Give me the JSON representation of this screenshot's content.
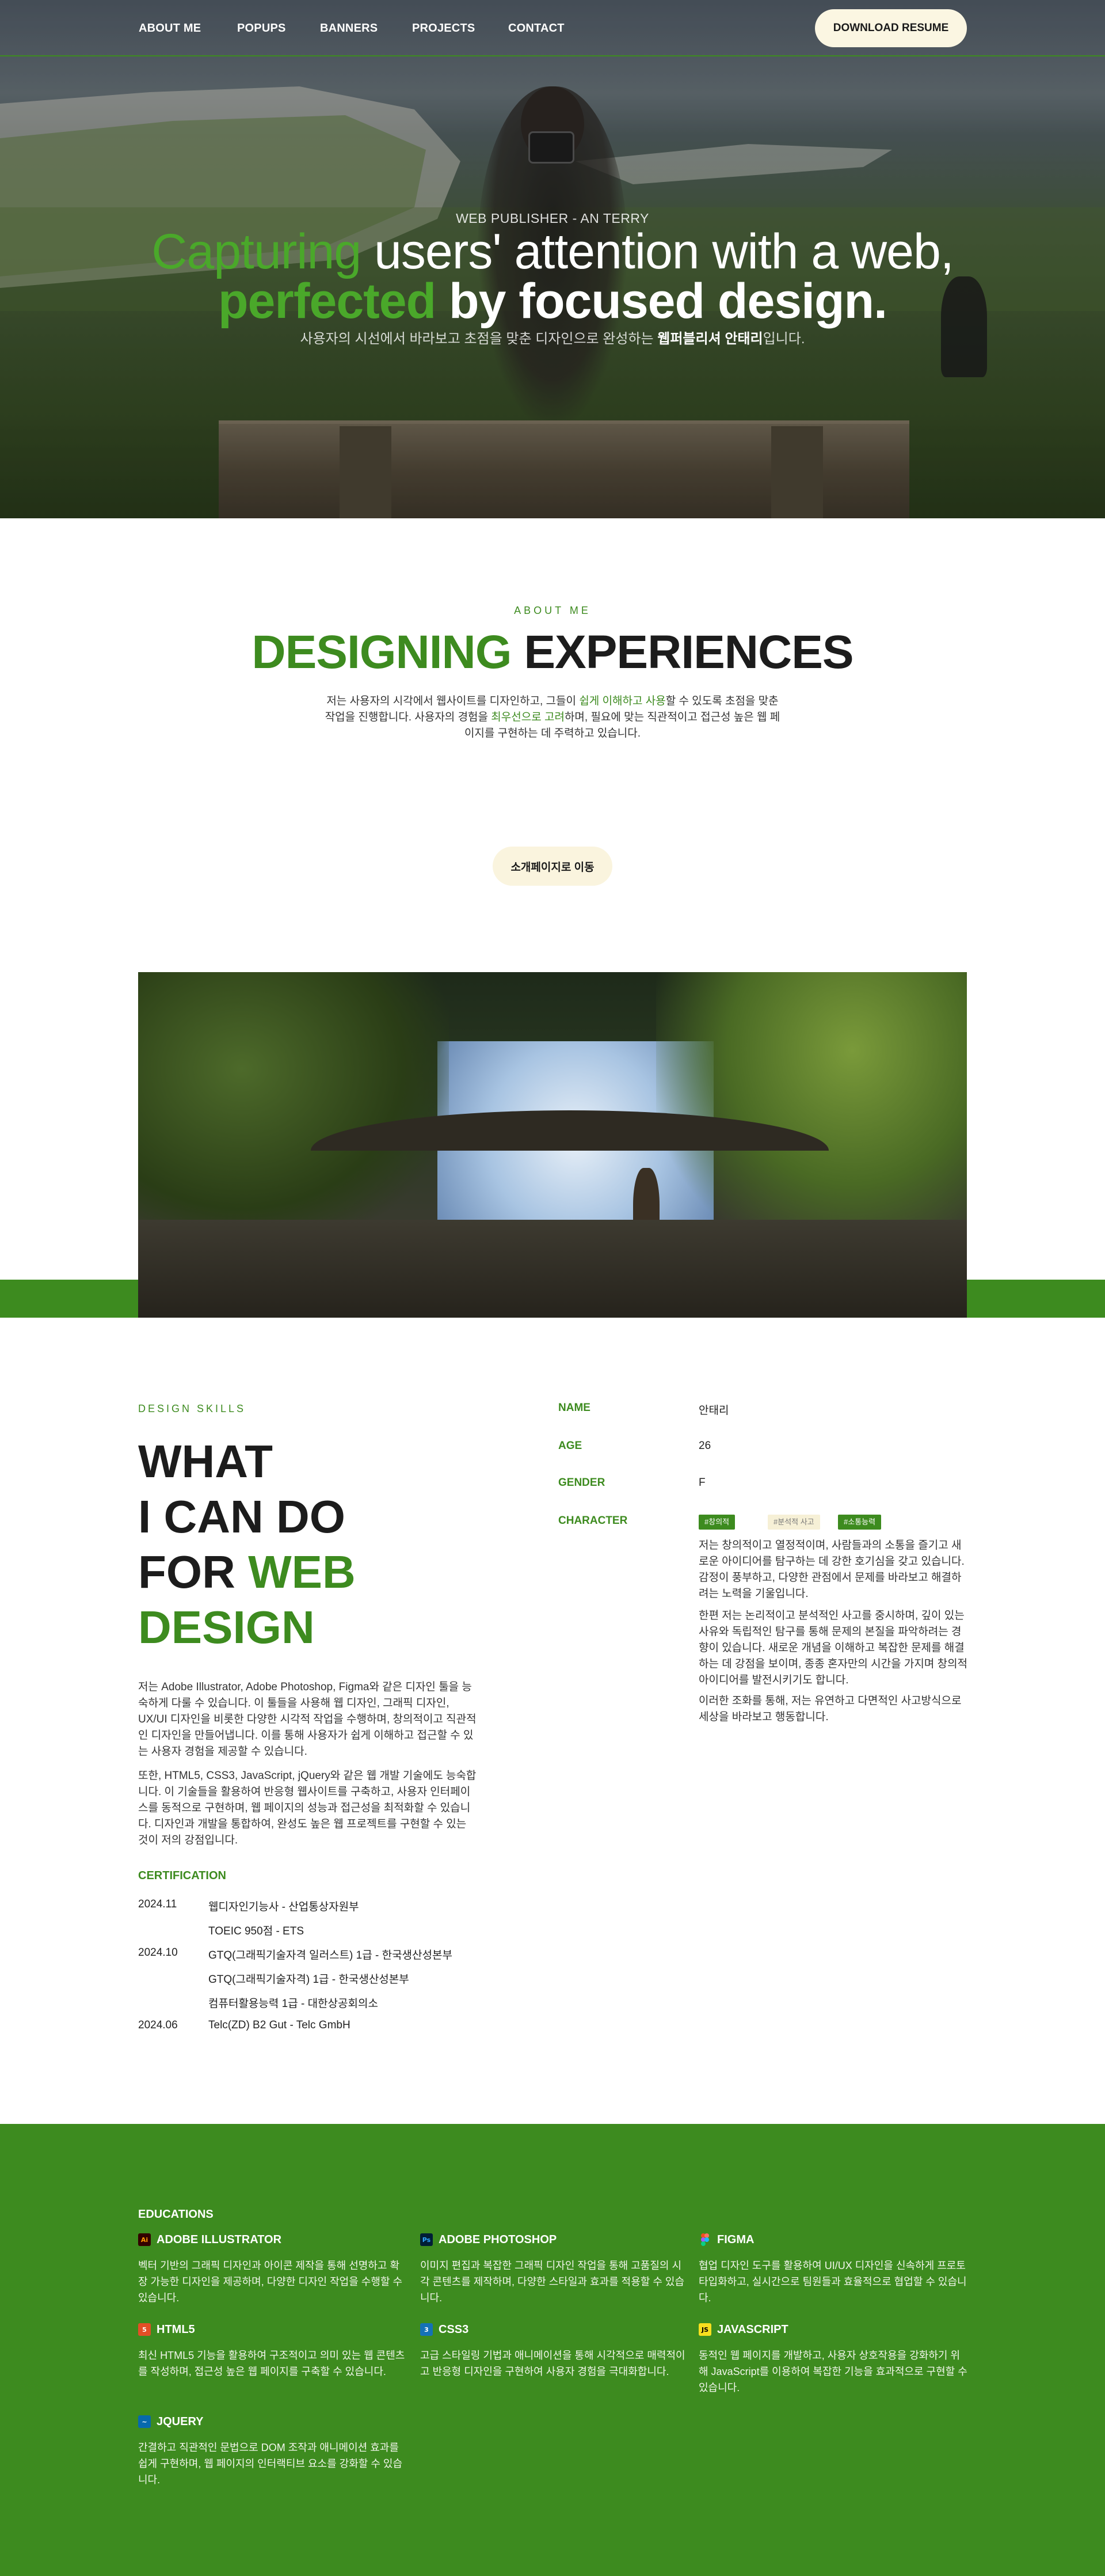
{
  "nav": {
    "items": [
      "ABOUT ME",
      "POPUPS",
      "BANNERS",
      "PROJECTS",
      "CONTACT"
    ],
    "resume_button": "DOWNLOAD RESUME"
  },
  "hero": {
    "subtitle": "WEB PUBLISHER - AN TERRY",
    "line1_green": "Capturing",
    "line1_rest": " users' attention with a web,",
    "line2_green": "perfected",
    "line2_rest": " by focused design.",
    "desc_pre": "사용자의 시선에서 바라보고 초점을 맞춘 디자인으로 완성하는 ",
    "desc_bold": "웹퍼블리셔 안태리",
    "desc_post": "입니다."
  },
  "about": {
    "label": "ABOUT ME",
    "title_green": "DESIGNING",
    "title_rest": " EXPERIENCES",
    "text_1": "저는 사용자의 시각에서 웹사이트를 디자인하고, 그들이 ",
    "text_hl1": "쉽게 이해하고 사용",
    "text_2": "할 수 있도록 초점을 맞춘 작업을 진행합니다. 사용자의 경험을 ",
    "text_hl2": "최우선으로 고려",
    "text_3": "하며, 필요에 맞는 직관적이고 접근성 높은 웹 페이지를 구현하는 데 주력하고 있습니다.",
    "button": "소개페이지로 이동"
  },
  "skills": {
    "label": "DESIGN SKILLS",
    "title_l1": "WHAT",
    "title_l2": "I CAN DO",
    "title_l3a": "FOR ",
    "title_l3b": "WEB",
    "title_l4": "DESIGN",
    "p1": "저는 Adobe Illustrator, Adobe Photoshop, Figma와 같은 디자인 툴을 능숙하게 다룰 수 있습니다. 이 툴들을 사용해 웹 디자인, 그래픽 디자인, UX/UI 디자인을 비롯한 다양한 시각적 작업을 수행하며, 창의적이고 직관적인 디자인을 만들어냅니다. 이를 통해 사용자가 쉽게 이해하고 접근할 수 있는 사용자 경험을 제공할 수 있습니다.",
    "p2": "또한, HTML5, CSS3, JavaScript, jQuery와 같은 웹 개발 기술에도 능숙합니다. 이 기술들을 활용하여 반응형 웹사이트를 구축하고, 사용자 인터페이스를 동적으로 구현하며, 웹 페이지의 성능과 접근성을 최적화할 수 있습니다. 디자인과 개발을 통합하여, 완성도 높은 웹 프로젝트를 구현할 수 있는 것이 저의 강점입니다.",
    "cert_title": "CERTIFICATION",
    "certs": [
      {
        "date": "2024.11",
        "name": "웹디자인기능사 - 산업통상자원부"
      },
      {
        "date": "",
        "name": "TOEIC 950점 - ETS"
      },
      {
        "date": "2024.10",
        "name": "GTQ(그래픽기술자격 일러스트) 1급 - 한국생산성본부"
      },
      {
        "date": "",
        "name": "GTQ(그래픽기술자격) 1급 - 한국생산성본부"
      },
      {
        "date": "",
        "name": "컴퓨터활용능력 1급 - 대한상공회의소"
      },
      {
        "date": "2024.06",
        "name": "Telc(ZD) B2 Gut - Telc GmbH"
      }
    ]
  },
  "profile": {
    "name_key": "NAME",
    "name_val": "안태리",
    "age_key": "AGE",
    "age_val": "26",
    "gender_key": "GENDER",
    "gender_val": "F",
    "character_key": "CHARACTER",
    "tags": [
      "#창의적",
      "#분석적 사고",
      "#소통능력"
    ],
    "tag_colors": [
      "#3d8b1f",
      "#f6f0d6",
      "#3d8b1f"
    ],
    "c1": "저는 창의적이고 열정적이며, 사람들과의 소통을 즐기고 새로운 아이디어를 탐구하는 데 강한 호기심을 갖고 있습니다. 감정이 풍부하고, 다양한 관점에서 문제를 바라보고 해결하려는 노력을 기울입니다.",
    "c2": "한편 저는 논리적이고 분석적인 사고를 중시하며, 깊이 있는 사유와 독립적인 탐구를 통해 문제의 본질을 파악하려는 경향이 있습니다. 새로운 개념을 이해하고 복잡한 문제를 해결하는 데 강점을 보이며, 종종 혼자만의 시간을 가지며 창의적 아이디어를 발전시키기도 합니다.",
    "c3": "이러한 조화를 통해, 저는 유연하고 다면적인 사고방식으로 세상을 바라보고 행동합니다."
  },
  "educations": {
    "title": "EDUCATIONS",
    "items": [
      {
        "icon": "illustrator-icon",
        "badge": "Ai",
        "color": "#330000",
        "fg": "#ff9a00",
        "name": "ADOBE ILLUSTRATOR",
        "desc": "벡터 기반의 그래픽 디자인과 아이콘 제작을 통해 선명하고 확장 가능한 디자인을 제공하며, 다양한 디자인 작업을 수행할 수 있습니다."
      },
      {
        "icon": "photoshop-icon",
        "badge": "Ps",
        "color": "#001e36",
        "fg": "#31a8ff",
        "name": "ADOBE PHOTOSHOP",
        "desc": "이미지 편집과 복잡한 그래픽 디자인 작업을 통해 고품질의 시각 콘텐츠를 제작하며, 다양한 스타일과 효과를 적용할 수 있습니다."
      },
      {
        "icon": "figma-icon",
        "badge": "F",
        "color": "#3d8b1f",
        "fg": "#f24e1e",
        "name": "FIGMA",
        "desc": "협업 디자인 도구를 활용하여 UI/UX 디자인을 신속하게 프로토타입화하고, 실시간으로 팀원들과 효율적으로 협업할 수 있습니다."
      },
      {
        "icon": "html5-icon",
        "badge": "5",
        "color": "#e34f26",
        "fg": "#ffffff",
        "name": "HTML5",
        "desc": "최신 HTML5 기능을 활용하여 구조적이고 의미 있는 웹 콘텐츠를 작성하며, 접근성 높은 웹 페이지를 구축할 수 있습니다."
      },
      {
        "icon": "css3-icon",
        "badge": "3",
        "color": "#1572b6",
        "fg": "#ffffff",
        "name": "CSS3",
        "desc": "고급 스타일링 기법과 애니메이션을 통해 시각적으로 매력적이고 반응형 디자인을 구현하여 사용자 경험을 극대화합니다."
      },
      {
        "icon": "javascript-icon",
        "badge": "JS",
        "color": "#f7df1e",
        "fg": "#000000",
        "name": "JAVASCRIPT",
        "desc": "동적인 웹 페이지를 개발하고, 사용자 상호작용을 강화하기 위해 JavaScript를 이용하여 복잡한 기능을 효과적으로 구현할 수 있습니다."
      },
      {
        "icon": "jquery-icon",
        "badge": "~",
        "color": "#0769ad",
        "fg": "#ffffff",
        "name": "JQUERY",
        "desc": "간결하고 직관적인 문법으로 DOM 조작과 애니메이션 효과를 쉽게 구현하며, 웹 페이지의 인터랙티브 요소를 강화할 수 있습니다."
      }
    ]
  }
}
